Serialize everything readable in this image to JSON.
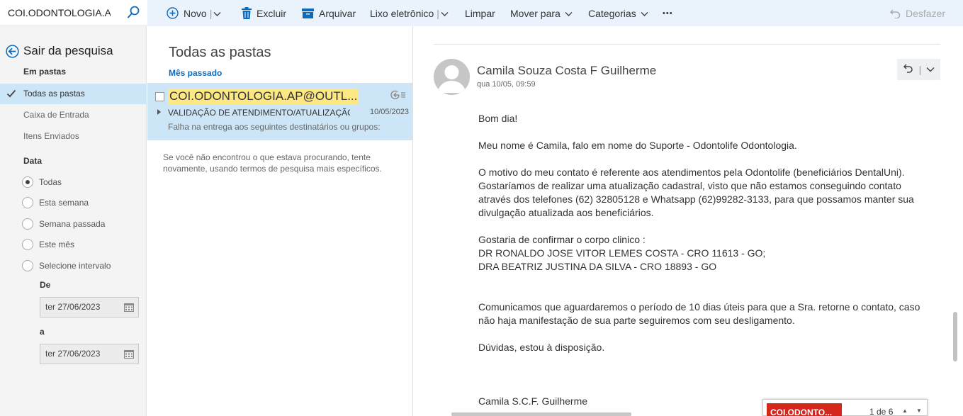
{
  "search": {
    "query": "COI.ODONTOLOGIA.AP@OUTLOOK.COM"
  },
  "left": {
    "back_label": "Sair da pesquisa",
    "in_folders_label": "Em pastas",
    "folders": [
      "Todas as pastas",
      "Caixa de Entrada",
      "Itens Enviados"
    ],
    "selected_folder": "Todas as pastas",
    "date_label": "Data",
    "date_options": [
      "Todas",
      "Esta semana",
      "Semana passada",
      "Este mês",
      "Selecione intervalo"
    ],
    "selected_date_option": "Todas",
    "from_label": "De",
    "from_value": "ter 27/06/2023",
    "to_label": "a",
    "to_value": "ter 27/06/2023"
  },
  "toolbar": {
    "new": "Novo",
    "delete": "Excluir",
    "archive": "Arquivar",
    "junk": "Lixo eletrônico",
    "clear": "Limpar",
    "move": "Mover para",
    "categories": "Categorias",
    "more": "•••",
    "undo": "Desfazer"
  },
  "list": {
    "title": "Todas as pastas",
    "group": "Mês passado",
    "message": {
      "from": "COI.ODONTOLOGIA.AP@OUTL...",
      "subject": "VALIDAÇÃO DE ATENDIMENTO/ATUALIZAÇÃO C",
      "date": "10/05/2023",
      "preview": "Falha na entrega aos seguintes destinatários ou grupos: C"
    },
    "hint": "Se você não encontrou o que estava procurando, tente novamente, usando termos de pesquisa mais específicos."
  },
  "reading": {
    "sender": "Camila Souza Costa F Guilherme",
    "when": "qua 10/05, 09:59",
    "body": [
      "Bom dia!",
      "",
      "Meu nome é Camila, falo em nome do Suporte - Odontolife Odontologia.",
      "",
      "O motivo do meu contato é referente aos atendimentos pela Odontolife (beneficiários DentalUni).",
      "Gostaríamos de realizar uma atualização cadastral, visto que não estamos conseguindo contato",
      "através dos telefones (62) 32805128 e Whatsapp (62)99282-3133, para que possamos manter sua",
      "divulgação atualizada aos beneficiários.",
      "",
      "Gostaria de confirmar o corpo clinico :",
      "DR RONALDO JOSE VITOR LEMES COSTA - CRO 11613 - GO;",
      "DRA BEATRIZ JUSTINA DA SILVA - CRO 18893 - GO",
      "",
      "",
      "Comunicamos que aguardaremos o período de 10 dias úteis para que a Sra. retorne o contato, caso",
      "não haja manifestação de sua parte seguiremos com seu desligamento.",
      "",
      "Dúvidas, estou à disposição.",
      "",
      "",
      "",
      "Camila S.C.F. Guilherme"
    ]
  },
  "popup": {
    "label": "COI.ODONTO...",
    "page": "1 de 6",
    "up": "▲",
    "down": "▼"
  },
  "colors": {
    "accent": "#0c6ac1",
    "selection": "#cde6f7",
    "highlight": "#fde883",
    "toolbar": "#eaf3fb",
    "attachment": "#d7261b"
  }
}
